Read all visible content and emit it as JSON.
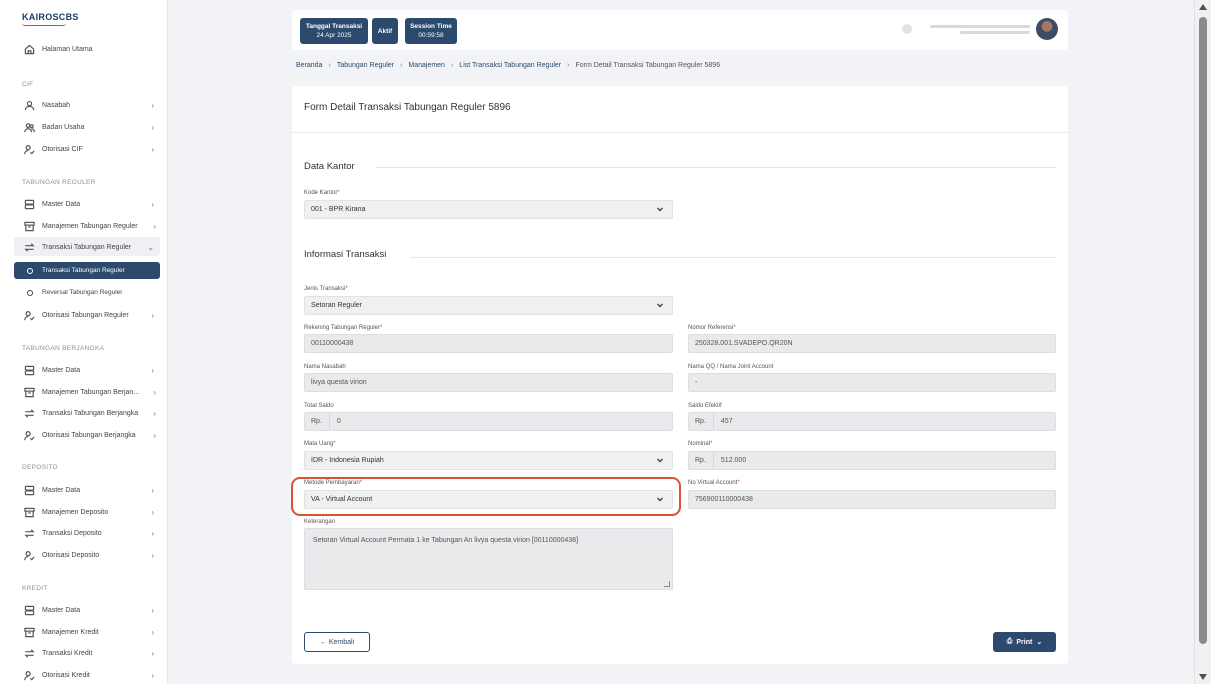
{
  "sidebar": {
    "logo": "KAIROSCBS",
    "home": "Halaman Utama",
    "cif_section": "CIF",
    "cif_items": [
      "Nasabah",
      "Badan Usaha",
      "Otorisasi CIF"
    ],
    "reguler_section": "TABUNGAN REGULER",
    "reguler_items": [
      "Master Data",
      "Manajemen Tabungan Reguler",
      "Transaksi Tabungan Reguler"
    ],
    "reguler_sub": [
      "Transaksi Tabungan Reguler",
      "Reversal Tabungan Reguler"
    ],
    "reguler_auth": "Otorisasi Tabungan Reguler",
    "berjangka_section": "TABUNGAN BERJANGKA",
    "berjangka_items": [
      "Master Data",
      "Manajemen Tabungan Berjan...",
      "Transaksi Tabungan Berjangka",
      "Otorisasi Tabungan Berjangka"
    ],
    "deposito_section": "DEPOSITO",
    "deposito_items": [
      "Master Data",
      "Manajemen Deposito",
      "Transaksi Deposito",
      "Otorisasi Deposito"
    ],
    "kredit_section": "KREDIT",
    "kredit_items": [
      "Master Data",
      "Manajemen Kredit",
      "Transaksi Kredit",
      "Otorisasi Kredit"
    ]
  },
  "topbar": {
    "tanggal_title": "Tanggal Transaksi",
    "tanggal_value": "24 Apr 2025",
    "status": "Aktif",
    "session_title": "Session Time",
    "session_value": "00:59:58"
  },
  "breadcrumb": [
    "Beranda",
    "Tabungan Reguler",
    "Manajemen",
    "List Transaksi Tabungan Reguler",
    "Form Detail Transaksi Tabungan Reguler 5896"
  ],
  "form": {
    "title": "Form Detail Transaksi Tabungan Reguler 5896",
    "section_kantor": "Data Kantor",
    "kode_kantor_label": "Kode Kantor",
    "kode_kantor_value": "001 - BPR Kirana",
    "section_transaksi": "Informasi Transaksi",
    "jenis_label": "Jenis Transaksi",
    "jenis_value": "Setoran Reguler",
    "rekening_label": "Rekening Tabungan Reguler",
    "rekening_value": "00110000438",
    "referensi_label": "Nomor Referensi",
    "referensi_value": "250328.001.SVADEPO.QR20N",
    "nama_label": "Nama Nasabah",
    "nama_value": "livya questa virion",
    "qq_label": "Nama QQ / Nama Joint Account",
    "qq_value": "-",
    "saldo_label": "Total Saldo",
    "saldo_prefix": "Rp.",
    "saldo_value": "0",
    "efektif_label": "Saldo Efektif",
    "efektif_prefix": "Rp.",
    "efektif_value": "457",
    "mata_uang_label": "Mata Uang",
    "mata_uang_value": "IDR - Indonesia Rupiah",
    "nominal_label": "Nominal",
    "nominal_prefix": "Rp.",
    "nominal_value": "512.000",
    "metode_label": "Metode Pembayaran",
    "metode_value": "VA - Virtual Account",
    "va_label": "No Virtual Account",
    "va_value": "756900110000438",
    "keterangan_label": "Keterangan",
    "keterangan_value": "Setoran Virtual Account Permata 1 ke Tabungan An livya questa virion [00110000438]",
    "back_label": "← Kembali",
    "print_label": "Print"
  },
  "colors": {
    "primary": "#2c4a6e",
    "highlight": "#d9532f",
    "required": "#d9462f"
  }
}
